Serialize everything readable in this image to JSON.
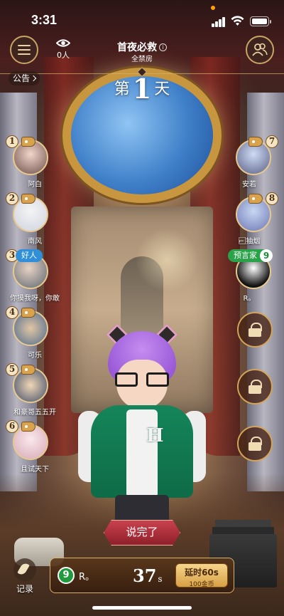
{
  "status_bar": {
    "time": "3:31"
  },
  "header": {
    "viewer_count": "0人",
    "mode_title": "首夜必救",
    "info_glyph": "i",
    "mode_subtitle": "全禁房",
    "notice_label": "公告"
  },
  "day": {
    "prefix": "第",
    "number": "1",
    "suffix": "天"
  },
  "players_left": [
    {
      "num": "1",
      "name": "阿白",
      "badge": ""
    },
    {
      "num": "2",
      "name": "南风",
      "badge": ""
    },
    {
      "num": "3",
      "name": "你摸我呀，你敢",
      "badge": "好人"
    },
    {
      "num": "4",
      "name": "可乐",
      "badge": ""
    },
    {
      "num": "5",
      "name": "和豪哥五五开",
      "badge": ""
    },
    {
      "num": "6",
      "name": "且试天下",
      "badge": ""
    }
  ],
  "players_right": [
    {
      "num": "7",
      "name": "安若",
      "badge": ""
    },
    {
      "num": "8",
      "name": "⌐ ⃞⃞抽烟",
      "badge": ""
    },
    {
      "num": "9",
      "name": "R。",
      "badge": "预言家"
    }
  ],
  "locked_seats": 3,
  "actions": {
    "speak_done": "说完了",
    "record": "记录"
  },
  "speaker": {
    "num": "9",
    "name": "R。",
    "seconds_left": "37",
    "seconds_unit": "s",
    "extend_label": "延时60s",
    "extend_cost": "100金币"
  },
  "colors": {
    "gold_border": "#d6b26e",
    "speak_done_red": "#c8424e",
    "prophet_green": "#2aa24a",
    "good_blue": "#2f8fd8"
  },
  "icons": [
    "hamburger-icon",
    "eye-icon",
    "info-icon",
    "players-icon",
    "tag-icon",
    "lock-icon",
    "quill-icon",
    "signal-icon",
    "wifi-icon",
    "battery-icon"
  ]
}
